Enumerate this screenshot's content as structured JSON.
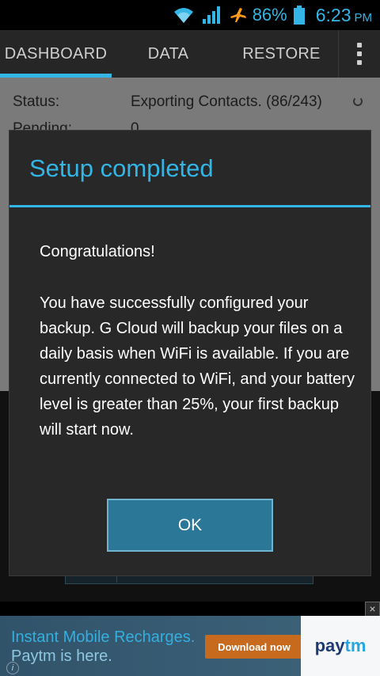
{
  "status_bar": {
    "battery": "86%",
    "time": "6:23",
    "ampm": "PM",
    "icons": [
      "wifi-icon",
      "signal-icon",
      "airplane-icon",
      "battery-icon"
    ],
    "accent": "#33b5e5"
  },
  "tabs": [
    {
      "label": "DASHBOARD",
      "active": true
    },
    {
      "label": "DATA",
      "active": false
    },
    {
      "label": "RESTORE",
      "active": false
    }
  ],
  "background": {
    "status_label": "Status:",
    "status_value": "Exporting Contacts. (86/243)",
    "pending_label": "Pending:",
    "pending_value": "0"
  },
  "dialog": {
    "title": "Setup completed",
    "heading": "Congratulations!",
    "body": "You have successfully configured your backup. G Cloud will backup your files on a daily basis when WiFi is available. If you are currently connected to WiFi, and your battery level is greater than 25%, your first backup will start now.",
    "ok_label": "OK"
  },
  "ad": {
    "line1": "Instant Mobile Recharges.",
    "line2": "Paytm is here.",
    "cta": "Download now",
    "brand_a": "pay",
    "brand_b": "tm",
    "close": "×",
    "info": "i"
  }
}
